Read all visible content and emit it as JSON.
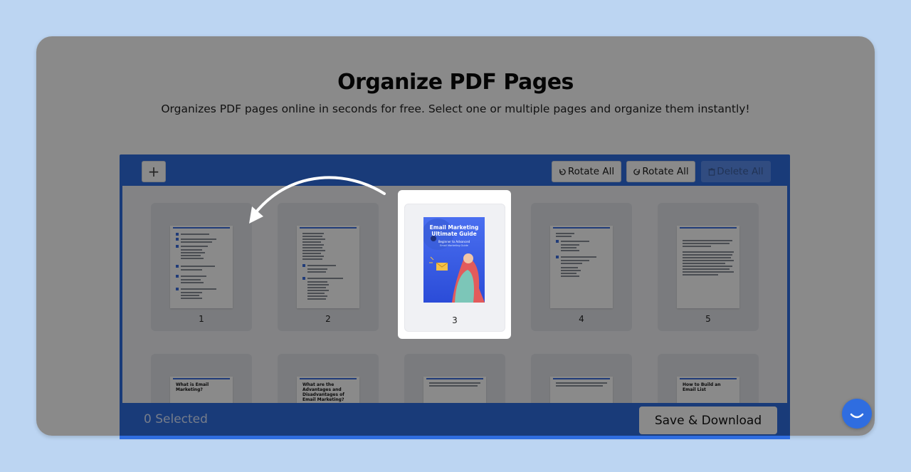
{
  "header": {
    "title": "Organize PDF Pages",
    "subtitle": "Organizes PDF pages online in seconds for free. Select one or multiple pages and organize them instantly!"
  },
  "toolbar": {
    "add_label": "+",
    "rotate_left_label": "Rotate All",
    "rotate_right_label": "Rotate All",
    "delete_label": "Delete All"
  },
  "pages": [
    {
      "number": "1"
    },
    {
      "number": "2"
    },
    {
      "number": "3"
    },
    {
      "number": "4"
    },
    {
      "number": "5"
    }
  ],
  "second_row": {
    "p6_heading": "What is Email Marketing?",
    "p7_heading": "What are the Advantages and Disadvantages of Email Marketing?",
    "p10_heading": "How to Build an Email List"
  },
  "cover": {
    "title": "Email Marketing Ultimate Guide",
    "subtitle": "Beginner to Advanced",
    "tagline": "Email Marketing Guide"
  },
  "footer": {
    "selected_text": "0 Selected",
    "save_label": "Save & Download"
  },
  "colors": {
    "accent": "#2f6de0",
    "background": "#bcd5f2"
  }
}
